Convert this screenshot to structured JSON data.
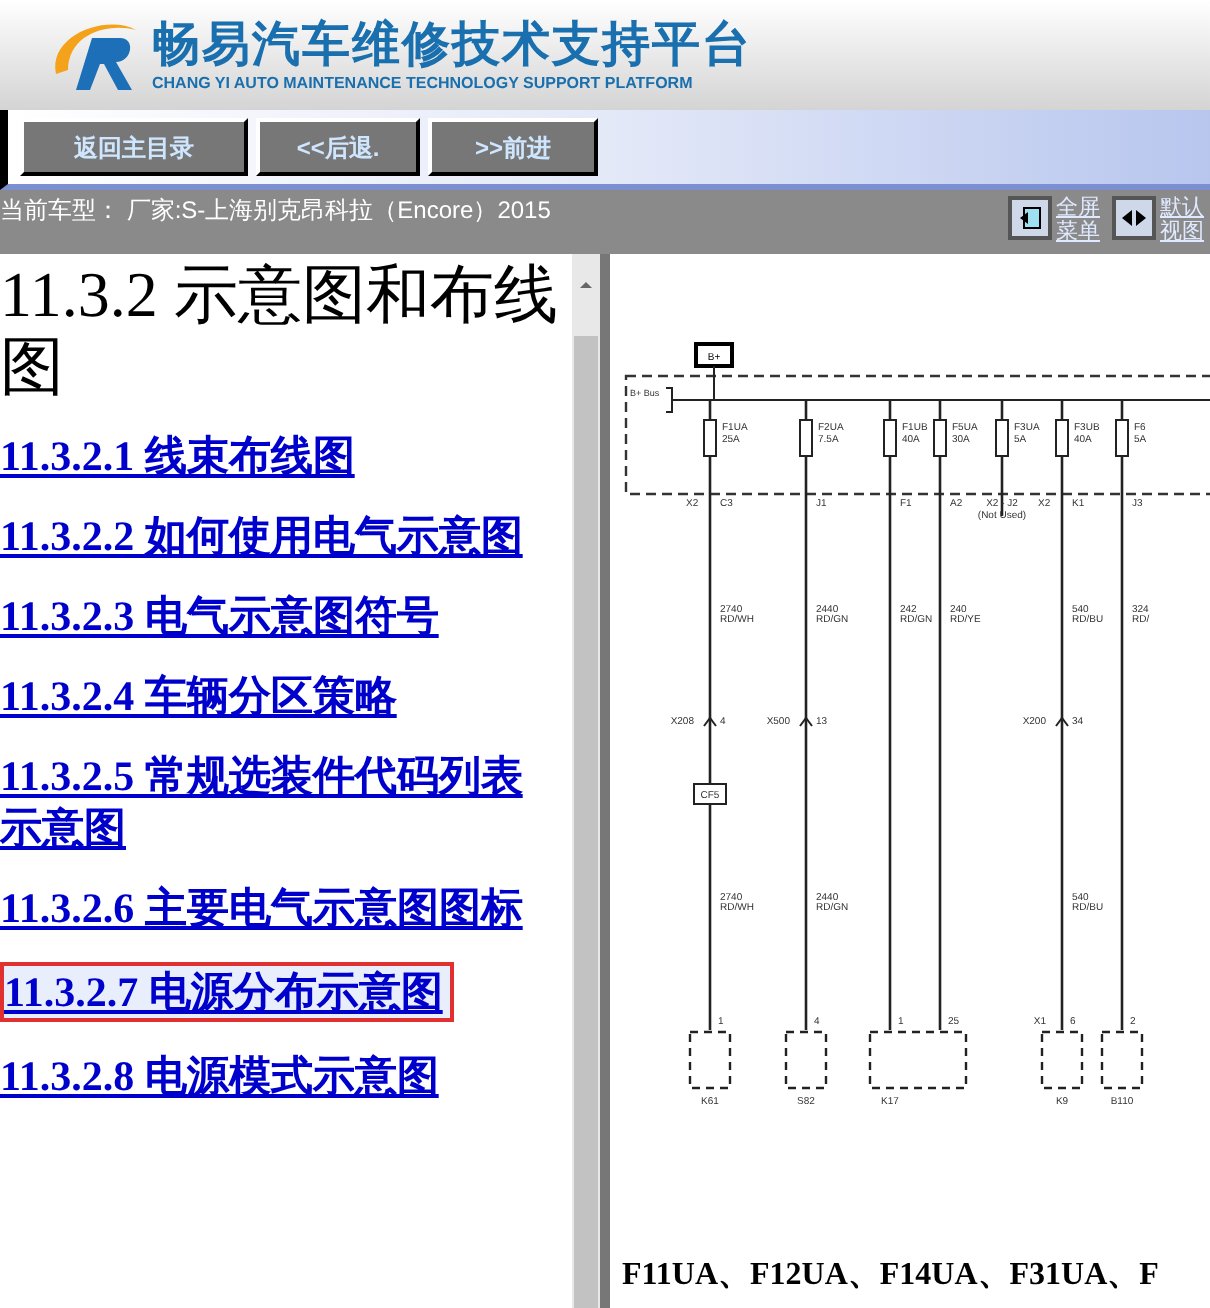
{
  "header": {
    "title": "畅易汽车维修技术支持平台",
    "subtitle": "CHANG YI AUTO MAINTENANCE TECHNOLOGY SUPPORT PLATFORM"
  },
  "toolbar": {
    "buttons": [
      "返回主目录",
      "<<后退.",
      ">>前进"
    ]
  },
  "info_bar": {
    "vehicle": "当前车型： 厂家:S-上海别克昂科拉（Encore）2015",
    "actions": [
      {
        "kind": "fullscreen",
        "label": "全屏菜单"
      },
      {
        "kind": "split",
        "label": "默认视图"
      }
    ]
  },
  "sidebar": {
    "heading": "11.3.2 示意图和布线图",
    "items": [
      {
        "label": "11.3.2.1 线束布线图",
        "selected": false
      },
      {
        "label": "11.3.2.2 如何使用电气示意图",
        "selected": false
      },
      {
        "label": "11.3.2.3 电气示意图符号",
        "selected": false
      },
      {
        "label": "11.3.2.4 车辆分区策略",
        "selected": false
      },
      {
        "label": "11.3.2.5 常规选装件代码列表示意图",
        "selected": false
      },
      {
        "label": "11.3.2.6 主要电气示意图图标",
        "selected": false
      },
      {
        "label": "11.3.2.7 电源分布示意图",
        "selected": true
      },
      {
        "label": "11.3.2.8 电源模式示意图",
        "selected": false
      }
    ]
  },
  "diagram": {
    "source": "B+",
    "bus": "B+ Bus",
    "columns": [
      {
        "fuse": "F1UA",
        "rating": "25A",
        "connector": "X2",
        "pin": "C3",
        "wire": "2740",
        "wire_color": "RD/WH",
        "inline": "X208",
        "inline_pin": "4",
        "splice": "CF5",
        "lower_wire": "2740",
        "lower_color": "RD/WH",
        "device_pin": "1",
        "device": "K61"
      },
      {
        "fuse": "F2UA",
        "rating": "7.5A",
        "pin": "J1",
        "wire": "2440",
        "wire_color": "RD/GN",
        "inline": "X500",
        "inline_pin": "13",
        "lower_wire": "2440",
        "lower_color": "RD/GN",
        "device_pin": "4",
        "device": "S82"
      },
      {
        "fuse": "F1UB",
        "rating": "40A",
        "pin": "F1",
        "wire": "242",
        "wire_color": "RD/GN",
        "device_pin": "1",
        "device": "K17"
      },
      {
        "fuse": "F5UA",
        "rating": "30A",
        "pin": "A2",
        "wire": "240",
        "wire_color": "RD/YE",
        "device_pin": "25"
      },
      {
        "fuse": "F3UA",
        "rating": "5A",
        "pin": "X2 - J2",
        "note": "(Not Used)"
      },
      {
        "fuse": "F3UB",
        "rating": "40A",
        "connector": "X2",
        "pin": "K1",
        "wire": "540",
        "wire_color": "RD/BU",
        "inline": "X200",
        "inline_pin": "34",
        "lower_wire": "540",
        "lower_color": "RD/BU",
        "device_connector": "X1",
        "device_pin": "6",
        "device": "K9"
      },
      {
        "fuse": "F6",
        "rating": "5A",
        "pin": "J3",
        "wire": "324",
        "wire_color": "RD/",
        "device_pin": "2",
        "device": "B110"
      }
    ]
  },
  "caption": "F11UA、F12UA、F14UA、F31UA、F"
}
